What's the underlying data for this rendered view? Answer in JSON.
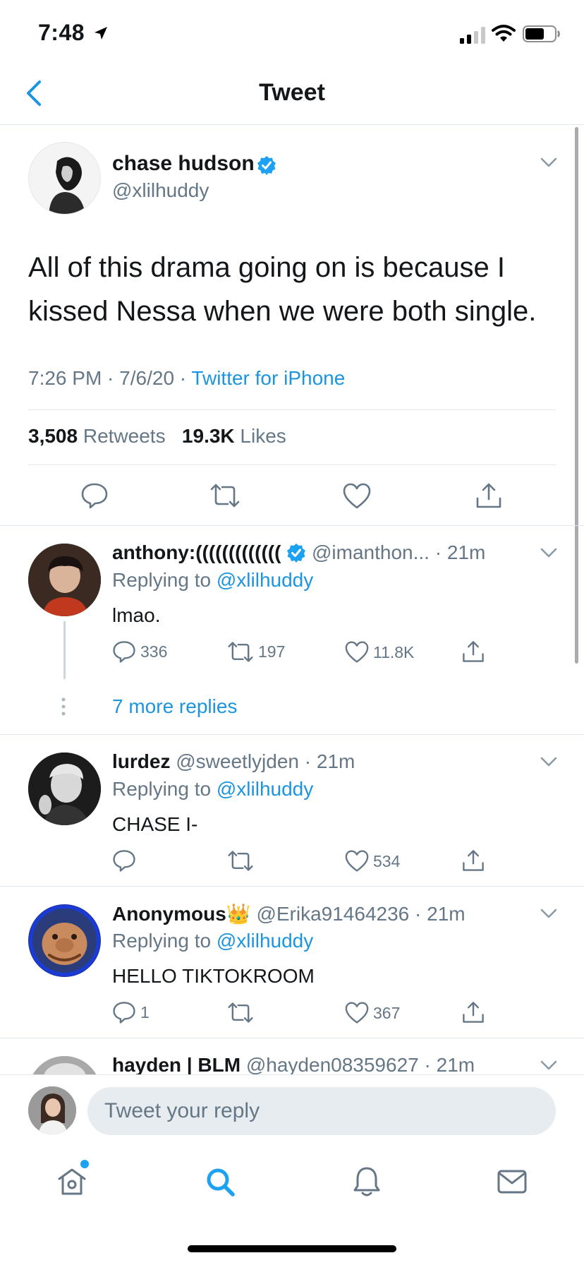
{
  "status_bar": {
    "time": "7:48"
  },
  "nav": {
    "title": "Tweet"
  },
  "main_tweet": {
    "name": "chase hudson",
    "handle": "@xlilhuddy",
    "text": "All of this drama going on is because I kissed Nessa when we were both single.",
    "time": "7:26 PM",
    "date": "7/6/20",
    "source": "Twitter for iPhone",
    "retweets_count": "3,508",
    "retweets_label": "Retweets",
    "likes_count": "19.3K",
    "likes_label": "Likes"
  },
  "replying_to_label": "Replying to",
  "replies": [
    {
      "name": "anthony:(((((((((((((",
      "handle": "@imanthon...",
      "time": "21m",
      "replying_to": "@xlilhuddy",
      "text": "lmao.",
      "reply_count": "336",
      "retweet_count": "197",
      "like_count": "11.8K"
    },
    {
      "name": "lurdez",
      "handle": "@sweetlyjden",
      "time": "21m",
      "replying_to": "@xlilhuddy",
      "text": "CHASE I-",
      "reply_count": "",
      "retweet_count": "",
      "like_count": "534"
    },
    {
      "name": "Anonymous👑",
      "handle": "@Erika91464236",
      "time": "21m",
      "replying_to": "@xlilhuddy",
      "text": "HELLO TIKTOKROOM",
      "reply_count": "1",
      "retweet_count": "",
      "like_count": "367"
    },
    {
      "name": "hayden | BLM",
      "handle": "@hayden08359627",
      "time": "21m"
    }
  ],
  "more_replies": "7 more replies",
  "compose": {
    "placeholder": "Tweet your reply"
  },
  "colors": {
    "accent": "#1b95e0",
    "text": "#14171a",
    "secondary": "#657786",
    "divider": "#e1e8ed"
  },
  "icons": [
    "location-arrow-icon",
    "signal-icon",
    "wifi-icon",
    "battery-icon",
    "back-chevron-icon",
    "verified-badge-icon",
    "chevron-down-icon",
    "reply-icon",
    "retweet-icon",
    "like-icon",
    "share-icon",
    "home-icon",
    "search-icon",
    "notifications-icon",
    "messages-icon"
  ]
}
